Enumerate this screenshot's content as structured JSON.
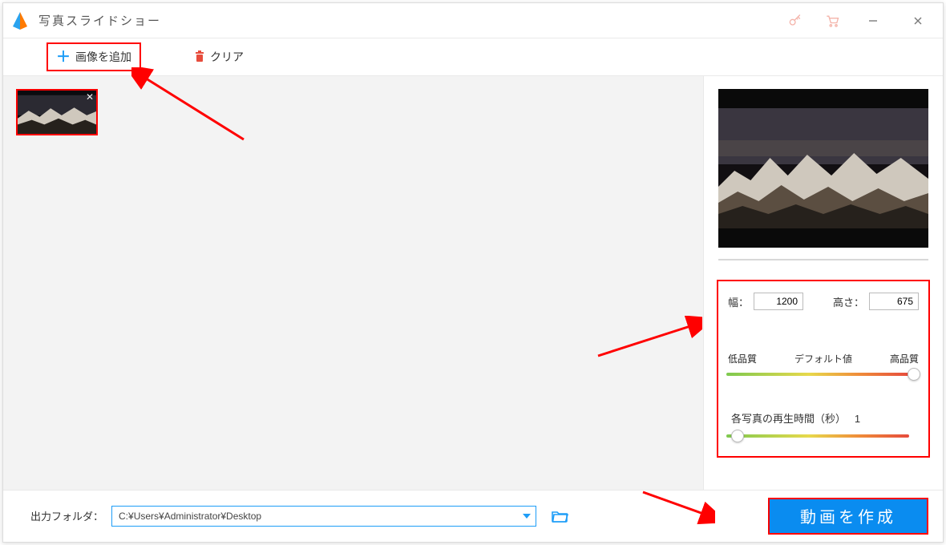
{
  "titlebar": {
    "app_title": "写真スライドショー"
  },
  "toolbar": {
    "add_image_label": "画像を追加",
    "clear_label": "クリア"
  },
  "sidebar": {
    "width_label": "幅：",
    "width_value": "1200",
    "height_label": "高さ：",
    "height_value": "675",
    "quality_low": "低品質",
    "quality_default": "デフォルト値",
    "quality_high": "高品質",
    "duration_label": "各写真の再生時間（秒）",
    "duration_value": "1"
  },
  "footer": {
    "output_label": "出力フォルダ：",
    "output_path": "C:¥Users¥Administrator¥Desktop",
    "create_label": "動画を作成"
  }
}
